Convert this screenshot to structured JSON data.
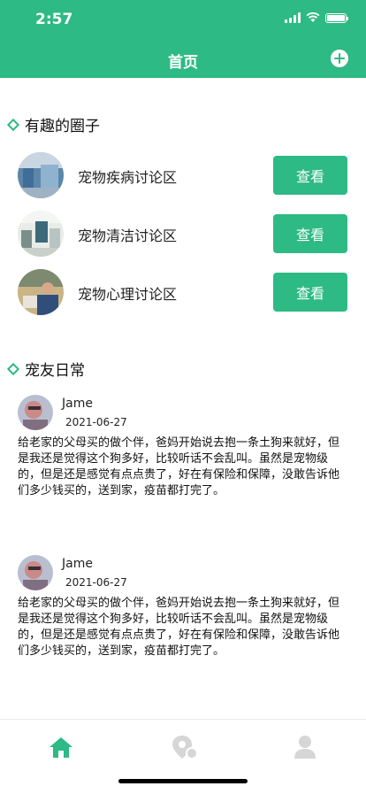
{
  "status": {
    "time": "2:57"
  },
  "header": {
    "title": "首页"
  },
  "circles": {
    "section_title": "有趣的圈子",
    "items": [
      {
        "label": "宠物疾病讨论区",
        "button": "查看"
      },
      {
        "label": "宠物清洁讨论区",
        "button": "查看"
      },
      {
        "label": "宠物心理讨论区",
        "button": "查看"
      }
    ]
  },
  "daily": {
    "section_title": "宠友日常",
    "posts": [
      {
        "name": "Jame",
        "date": "2021-06-27",
        "text": "给老家的父母买的做个伴，爸妈开始说去抱一条土狗来就好，但是我还是觉得这个狗多好，比较听话不会乱叫。虽然是宠物级的，但是还是感觉有点点贵了，好在有保险和保障，没敢告诉他们多少钱买的，送到家，疫苗都打完了。"
      },
      {
        "name": "Jame",
        "date": "2021-06-27",
        "text": "给老家的父母买的做个伴，爸妈开始说去抱一条土狗来就好，但是我还是觉得这个狗多好，比较听话不会乱叫。虽然是宠物级的，但是还是感觉有点点贵了，好在有保险和保障，没敢告诉他们多少钱买的，送到家，疫苗都打完了。"
      }
    ]
  },
  "tabbar": {
    "items": [
      {
        "icon": "home-icon",
        "active": true
      },
      {
        "icon": "map-pin-icon",
        "active": false
      },
      {
        "icon": "user-icon",
        "active": false
      }
    ]
  },
  "colors": {
    "accent": "#2dba84",
    "inactive_icon": "#d6d6d6"
  }
}
